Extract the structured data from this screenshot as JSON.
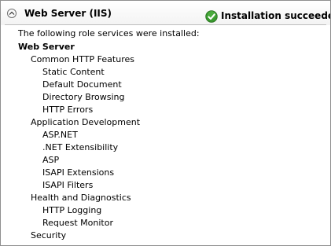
{
  "header": {
    "title": "Web Server (IIS)",
    "status": "Installation succeeded",
    "status_color": "#3a9a2f"
  },
  "intro": "The following role services were installed:",
  "role": "Web Server",
  "groups": [
    {
      "name": "Common HTTP Features",
      "items": [
        "Static Content",
        "Default Document",
        "Directory Browsing",
        "HTTP Errors"
      ]
    },
    {
      "name": "Application Development",
      "items": [
        "ASP.NET",
        ".NET Extensibility",
        "ASP",
        "ISAPI Extensions",
        "ISAPI Filters"
      ]
    },
    {
      "name": "Health and Diagnostics",
      "items": [
        "HTTP Logging",
        "Request Monitor"
      ]
    },
    {
      "name": "Security",
      "items": []
    }
  ]
}
